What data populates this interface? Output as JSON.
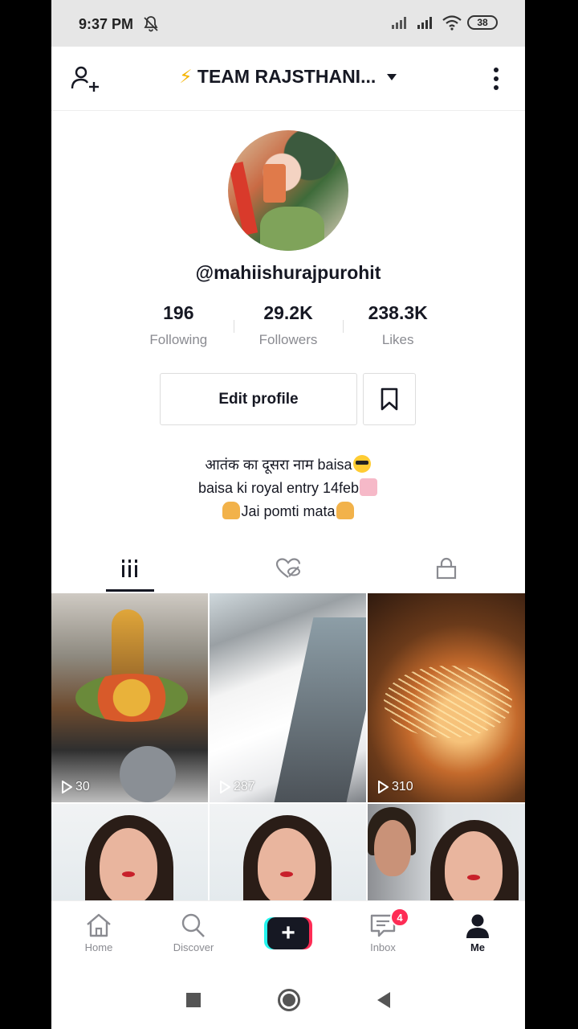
{
  "status_bar": {
    "time": "9:37 PM",
    "battery": "38"
  },
  "header": {
    "title": "TEAM RAJSTHANI...",
    "title_emoji": "⚡"
  },
  "profile": {
    "username": "@mahiishurajpurohit",
    "stats": [
      {
        "value": "196",
        "label": "Following"
      },
      {
        "value": "29.2K",
        "label": "Followers"
      },
      {
        "value": "238.3K",
        "label": "Likes"
      }
    ],
    "edit_label": "Edit profile",
    "bio": [
      "आतंक का दूसरा नाम baisa",
      "baisa ki royal entry 14feb",
      "Jai pomti mata"
    ]
  },
  "videos": [
    {
      "plays": "30"
    },
    {
      "plays": "287"
    },
    {
      "plays": "310"
    },
    {
      "plays": ""
    },
    {
      "plays": ""
    },
    {
      "plays": ""
    }
  ],
  "nav": {
    "home": "Home",
    "discover": "Discover",
    "plus": "+",
    "inbox": "Inbox",
    "inbox_badge": "4",
    "me": "Me"
  },
  "colors": {
    "accent_red": "#fe2c55",
    "accent_cyan": "#25f4ee",
    "text_dark": "#161823",
    "text_muted": "#8a8b91"
  }
}
